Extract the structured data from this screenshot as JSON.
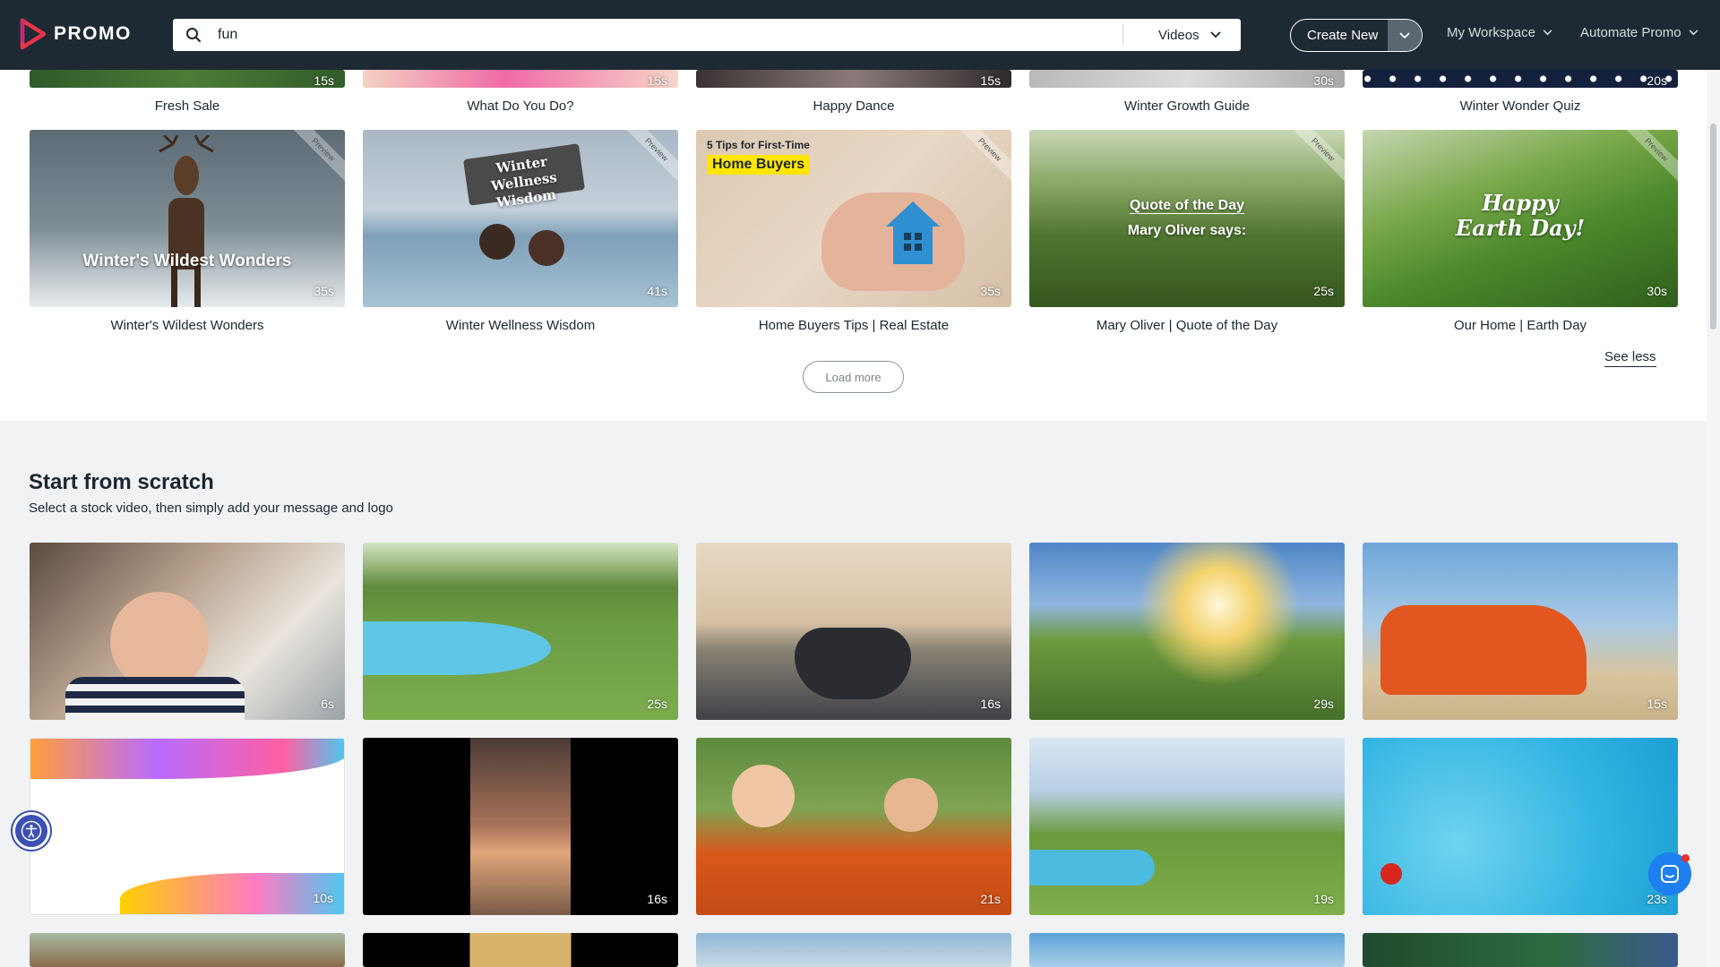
{
  "header": {
    "logo_text": "PROMO",
    "search_value": "fun",
    "search_type": "Videos",
    "create_new": "Create New",
    "nav": [
      "My Workspace",
      "Automate Promo"
    ]
  },
  "top_row": [
    {
      "title": "Fresh Sale",
      "duration": "15s"
    },
    {
      "title": "What Do You Do?",
      "duration": "15s"
    },
    {
      "title": "Happy Dance",
      "duration": "15s"
    },
    {
      "title": "Winter Growth Guide",
      "duration": "30s"
    },
    {
      "title": "Winter Wonder Quiz",
      "duration": "20s"
    }
  ],
  "templates": [
    {
      "title": "Winter's Wildest Wonders",
      "duration": "35s",
      "overlay": "Winter's Wildest Wonders",
      "ribbon": "Preview"
    },
    {
      "title": "Winter Wellness Wisdom",
      "duration": "41s",
      "overlay": "Winter Wellness Wisdom",
      "ribbon": "Preview"
    },
    {
      "title": "Home Buyers Tips | Real Estate",
      "duration": "35s",
      "overlay_small": "5 Tips for First-Time",
      "overlay_badge": "Home Buyers",
      "ribbon": "Preview"
    },
    {
      "title": "Mary Oliver | Quote of the Day",
      "duration": "25s",
      "overlay": "Quote of the Day",
      "overlay_2": "Mary Oliver says:",
      "ribbon": "Preview"
    },
    {
      "title": "Our Home | Earth Day",
      "duration": "30s",
      "overlay": "Happy Earth Day!",
      "ribbon": "Preview"
    }
  ],
  "load_more": "Load more",
  "see_less": "See less",
  "scratch": {
    "title": "Start from scratch",
    "subtitle": "Select a stock video, then simply add your message and logo",
    "row1": [
      {
        "duration": "6s"
      },
      {
        "duration": "25s"
      },
      {
        "duration": "16s"
      },
      {
        "duration": "29s"
      },
      {
        "duration": "15s"
      }
    ],
    "row2": [
      {
        "duration": "10s"
      },
      {
        "duration": "16s"
      },
      {
        "duration": "21s"
      },
      {
        "duration": "19s"
      },
      {
        "duration": "23s"
      }
    ]
  },
  "colors": {
    "header_bg": "#1e2a33",
    "brand_red": "#e8344a",
    "accessibility_blue": "#3b4fb5",
    "chat_blue": "#1e7ff0"
  }
}
